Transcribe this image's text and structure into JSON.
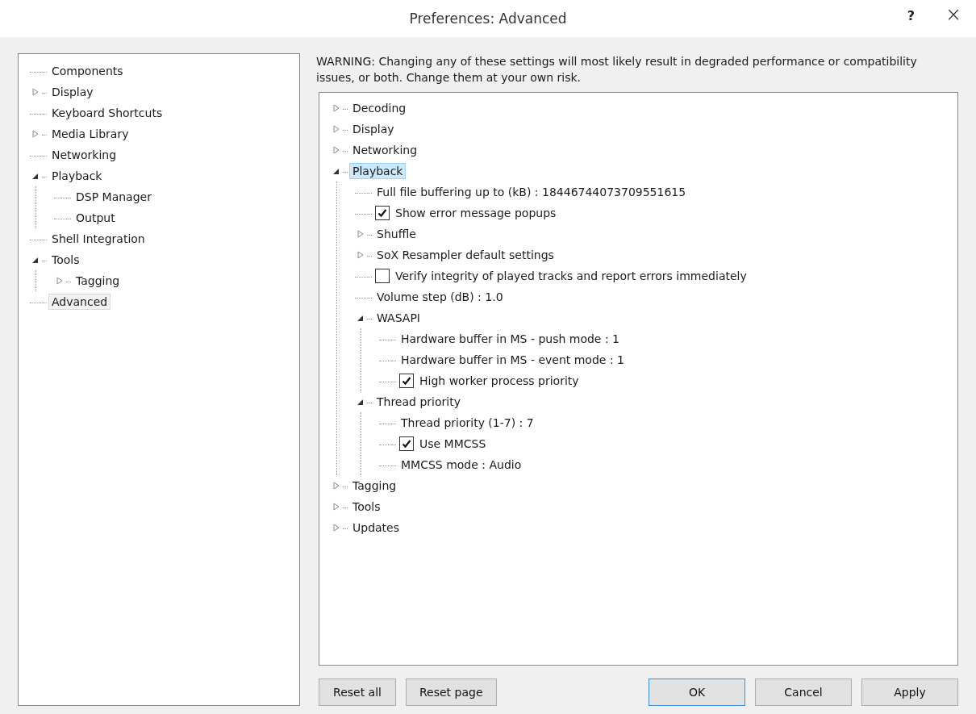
{
  "window": {
    "title": "Preferences: Advanced",
    "help": "?",
    "close": "×"
  },
  "categories": [
    {
      "label": "Components",
      "kind": "leaf",
      "selected": false
    },
    {
      "label": "Display",
      "kind": "branch",
      "expanded": false,
      "selected": false
    },
    {
      "label": "Keyboard Shortcuts",
      "kind": "leaf",
      "selected": false
    },
    {
      "label": "Media Library",
      "kind": "branch",
      "expanded": false,
      "selected": false
    },
    {
      "label": "Networking",
      "kind": "leaf",
      "selected": false
    },
    {
      "label": "Playback",
      "kind": "branch",
      "expanded": true,
      "selected": false,
      "children": [
        {
          "label": "DSP Manager",
          "kind": "leaf",
          "selected": false
        },
        {
          "label": "Output",
          "kind": "leaf",
          "selected": false
        }
      ]
    },
    {
      "label": "Shell Integration",
      "kind": "leaf",
      "selected": false
    },
    {
      "label": "Tools",
      "kind": "branch",
      "expanded": true,
      "selected": false,
      "children": [
        {
          "label": "Tagging",
          "kind": "branch",
          "expanded": false,
          "selected": false
        }
      ]
    },
    {
      "label": "Advanced",
      "kind": "leaf",
      "selected": true
    }
  ],
  "warning": "WARNING: Changing any of these settings will most likely result in degraded performance or compatibility issues, or both. Change them at your own risk.",
  "settings": [
    {
      "label": "Decoding",
      "kind": "branch",
      "expanded": false,
      "selected": false
    },
    {
      "label": "Display",
      "kind": "branch",
      "expanded": false,
      "selected": false
    },
    {
      "label": "Networking",
      "kind": "branch",
      "expanded": false,
      "selected": false
    },
    {
      "label": "Playback",
      "kind": "branch",
      "expanded": true,
      "selected": true,
      "children": [
        {
          "label": "Full file buffering up to (kB) : 18446744073709551615",
          "kind": "leaf",
          "selected": false
        },
        {
          "label": "Show error message popups",
          "kind": "checkbox",
          "checked": true,
          "selected": false
        },
        {
          "label": "Shuffle",
          "kind": "branch",
          "expanded": false,
          "selected": false
        },
        {
          "label": "SoX Resampler default settings",
          "kind": "branch",
          "expanded": false,
          "selected": false
        },
        {
          "label": "Verify integrity of played tracks and report errors immediately",
          "kind": "checkbox",
          "checked": false,
          "selected": false
        },
        {
          "label": "Volume step (dB) : 1.0",
          "kind": "leaf",
          "selected": false
        },
        {
          "label": "WASAPI",
          "kind": "branch",
          "expanded": true,
          "selected": false,
          "children": [
            {
              "label": "Hardware buffer in MS - push mode : 1",
              "kind": "leaf",
              "selected": false
            },
            {
              "label": "Hardware buffer in MS - event mode : 1",
              "kind": "leaf",
              "selected": false
            },
            {
              "label": "High worker process priority",
              "kind": "checkbox",
              "checked": true,
              "selected": false
            }
          ]
        },
        {
          "label": "Thread priority",
          "kind": "branch",
          "expanded": true,
          "selected": false,
          "children": [
            {
              "label": "Thread priority (1-7) : 7",
              "kind": "leaf",
              "selected": false
            },
            {
              "label": "Use MMCSS",
              "kind": "checkbox",
              "checked": true,
              "selected": false
            },
            {
              "label": "MMCSS mode : Audio",
              "kind": "leaf",
              "selected": false
            }
          ]
        }
      ]
    },
    {
      "label": "Tagging",
      "kind": "branch",
      "expanded": false,
      "selected": false
    },
    {
      "label": "Tools",
      "kind": "branch",
      "expanded": false,
      "selected": false
    },
    {
      "label": "Updates",
      "kind": "branch",
      "expanded": false,
      "selected": false
    }
  ],
  "buttons_left": [
    {
      "label": "Reset all",
      "default": false
    },
    {
      "label": "Reset page",
      "default": false
    }
  ],
  "buttons_right": [
    {
      "label": "OK",
      "default": true
    },
    {
      "label": "Cancel",
      "default": false
    },
    {
      "label": "Apply",
      "default": false
    }
  ]
}
